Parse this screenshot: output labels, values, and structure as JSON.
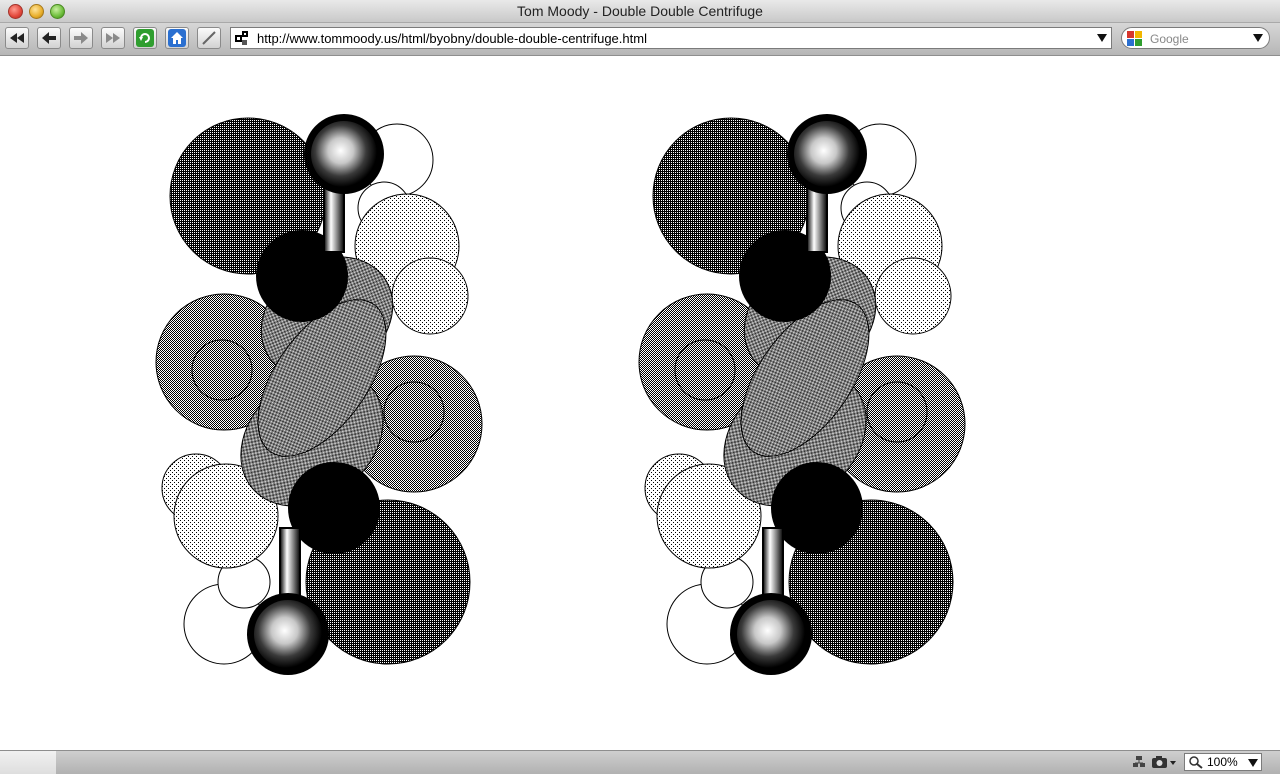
{
  "window": {
    "title": "Tom Moody - Double Double Centrifuge"
  },
  "toolbar": {
    "buttons": [
      {
        "name": "rewind-button",
        "icon": "rewind-icon"
      },
      {
        "name": "back-button",
        "icon": "back-arrow-icon"
      },
      {
        "name": "forward-button",
        "icon": "forward-arrow-icon"
      },
      {
        "name": "fast-forward-button",
        "icon": "fast-forward-icon"
      },
      {
        "name": "reload-button",
        "icon": "reload-icon"
      },
      {
        "name": "home-button",
        "icon": "home-icon"
      },
      {
        "name": "edit-button",
        "icon": "pen-icon"
      }
    ],
    "url": "http://www.tommoody.us/html/byobny/double-double-centrifuge.html"
  },
  "search": {
    "placeholder": "Google",
    "engine_icon": "google-icon"
  },
  "content": {
    "images": [
      {
        "name": "molecule-image-left"
      },
      {
        "name": "molecule-image-right"
      }
    ]
  },
  "statusbar": {
    "zoom": "100%"
  },
  "colors": {
    "accent_green": "#2f9e2f",
    "home_blue": "#2a6fd0",
    "page_background": "#ffffff"
  }
}
